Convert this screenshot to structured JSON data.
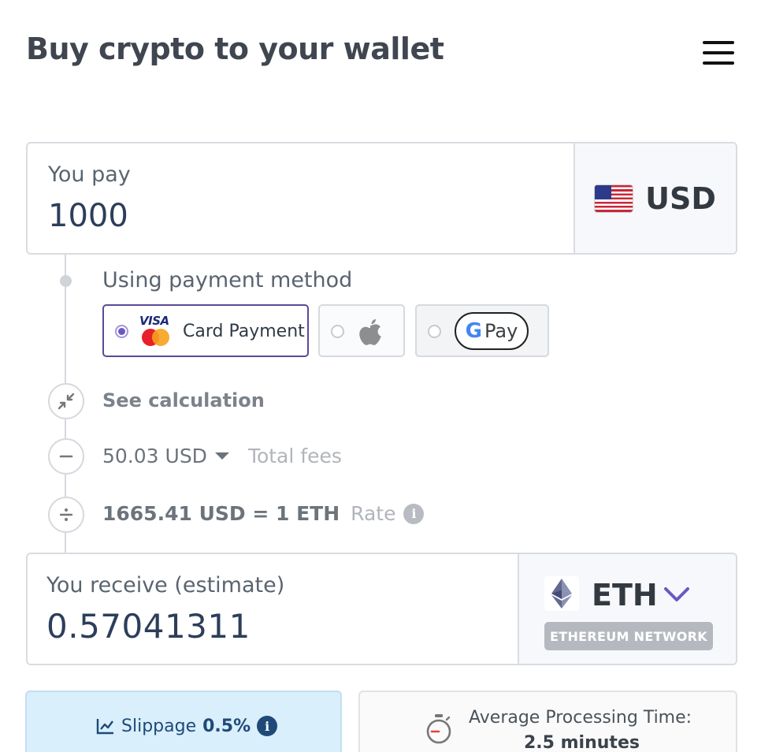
{
  "header": {
    "title": "Buy crypto to your wallet"
  },
  "pay": {
    "label": "You pay",
    "amount": "1000",
    "currency": "USD"
  },
  "payment_method": {
    "label": "Using payment method",
    "options": [
      {
        "id": "card",
        "label": "Card Payment",
        "brand_text": "VISA",
        "selected": true
      },
      {
        "id": "apple-pay",
        "selected": false
      },
      {
        "id": "google-pay",
        "brand_g": "G",
        "brand_text": "Pay",
        "selected": false
      }
    ]
  },
  "calculation": {
    "see_label": "See calculation",
    "fees_value": "50.03 USD",
    "fees_label": "Total fees",
    "rate_value": "1665.41 USD = 1 ETH",
    "rate_label": "Rate",
    "info_glyph": "i"
  },
  "receive": {
    "label": "You receive (estimate)",
    "amount": "0.57041311",
    "token": "ETH",
    "network": "ETHEREUM NETWORK"
  },
  "slippage": {
    "label": "Slippage",
    "value": "0.5%"
  },
  "processing": {
    "label": "Average Processing Time:",
    "value": "2.5 minutes"
  },
  "colors": {
    "accent": "#6b58c4",
    "text_dark": "#2c3e5a",
    "slippage_bg": "#d9effc",
    "slippage_text": "#1f4a78"
  }
}
